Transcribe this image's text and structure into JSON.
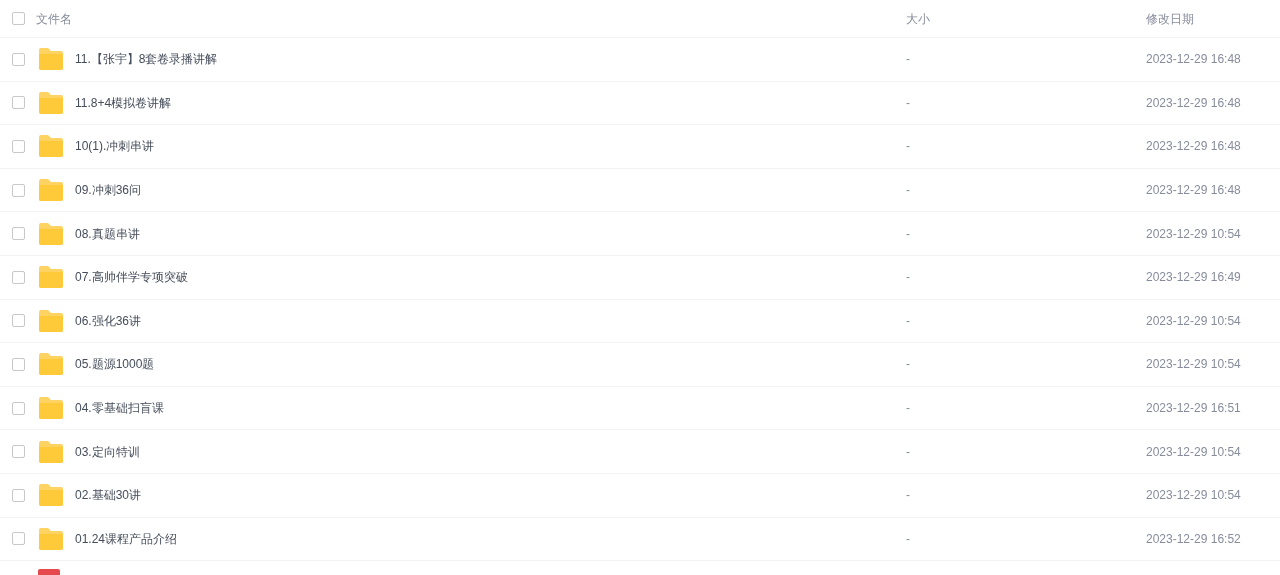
{
  "header": {
    "checked": false,
    "columns": [
      "文件名",
      "大小",
      "修改日期"
    ]
  },
  "rows": [
    {
      "kind": "folder",
      "checked": false,
      "name": "11.【张宇】8套卷录播讲解",
      "size": "-",
      "modified": "2023-12-29 16:48"
    },
    {
      "kind": "folder",
      "checked": false,
      "name": "11.8+4模拟卷讲解",
      "size": "-",
      "modified": "2023-12-29 16:48"
    },
    {
      "kind": "folder",
      "checked": false,
      "name": "10(1).冲刺串讲",
      "size": "-",
      "modified": "2023-12-29 16:48"
    },
    {
      "kind": "folder",
      "checked": false,
      "name": "09.冲刺36问",
      "size": "-",
      "modified": "2023-12-29 16:48"
    },
    {
      "kind": "folder",
      "checked": false,
      "name": "08.真题串讲",
      "size": "-",
      "modified": "2023-12-29 10:54"
    },
    {
      "kind": "folder",
      "checked": false,
      "name": "07.高帅伴学专项突破",
      "size": "-",
      "modified": "2023-12-29 16:49"
    },
    {
      "kind": "folder",
      "checked": false,
      "name": "06.强化36讲",
      "size": "-",
      "modified": "2023-12-29 10:54"
    },
    {
      "kind": "folder",
      "checked": false,
      "name": "05.题源1000题",
      "size": "-",
      "modified": "2023-12-29 10:54"
    },
    {
      "kind": "folder",
      "checked": false,
      "name": "04.零基础扫盲课",
      "size": "-",
      "modified": "2023-12-29 16:51"
    },
    {
      "kind": "folder",
      "checked": false,
      "name": "03.定向特训",
      "size": "-",
      "modified": "2023-12-29 10:54"
    },
    {
      "kind": "folder",
      "checked": false,
      "name": "02.基础30讲",
      "size": "-",
      "modified": "2023-12-29 10:54"
    },
    {
      "kind": "folder",
      "checked": false,
      "name": "01.24课程产品介绍",
      "size": "-",
      "modified": "2023-12-29 16:52"
    },
    {
      "kind": "pdf"
    }
  ]
}
